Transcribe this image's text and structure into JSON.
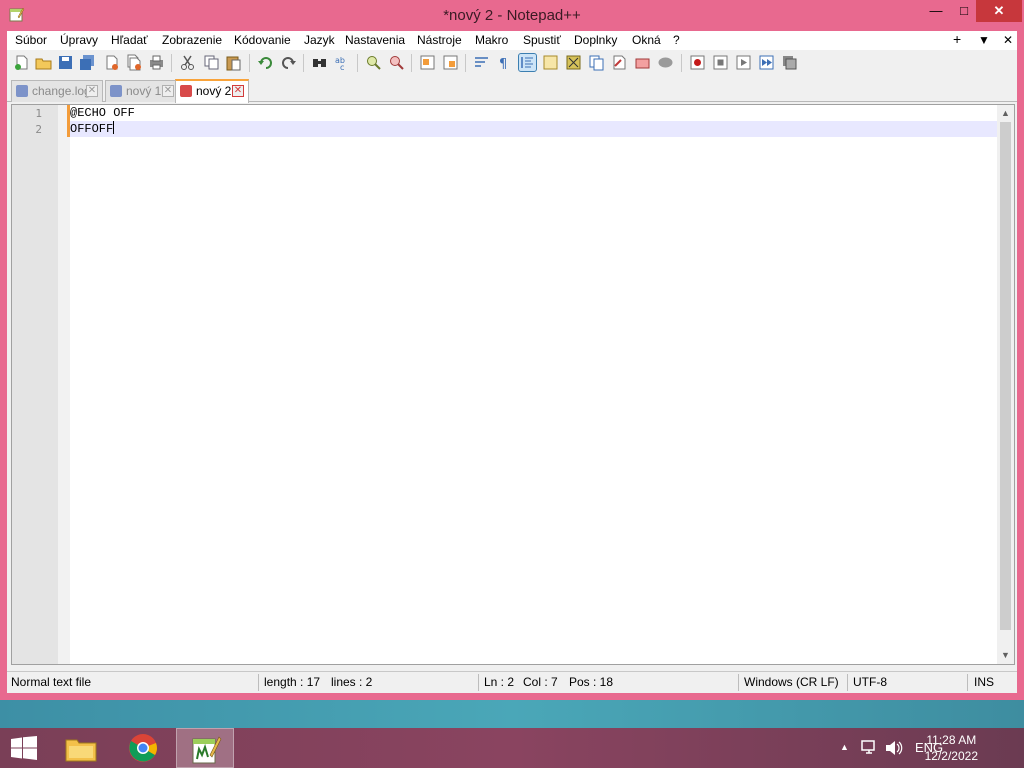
{
  "window": {
    "title": "*nový 2 - Notepad++",
    "min_glyph": "—",
    "max_glyph": "□",
    "close_glyph": "✕"
  },
  "menu": {
    "items": [
      "Súbor",
      "Úpravy",
      "Hľadať",
      "Zobrazenie",
      "Kódovanie",
      "Jazyk",
      "Nastavenia",
      "Nástroje",
      "Makro",
      "Spustiť",
      "Doplnky",
      "Okná",
      "?"
    ],
    "right": [
      "+",
      "▼",
      "✕"
    ]
  },
  "tabs": [
    {
      "label": "change.log",
      "active": false
    },
    {
      "label": "nový 1",
      "active": false
    },
    {
      "label": "nový 2",
      "active": true
    }
  ],
  "editor": {
    "lines": [
      {
        "number": "1",
        "text": "@ECHO OFF"
      },
      {
        "number": "2",
        "text": "OFFOFF"
      }
    ],
    "current_line": 2
  },
  "status": {
    "type": "Normal text file",
    "length": "length : 17",
    "lines": "lines : 2",
    "ln": "Ln : 2",
    "col": "Col : 7",
    "pos": "Pos : 18",
    "eol": "Windows (CR LF)",
    "encoding": "UTF-8",
    "mode": "INS"
  },
  "taskbar": {
    "language": "ENG",
    "time": "11:28 AM",
    "date": "12/2/2022"
  },
  "colors": {
    "frame": "#e8698f",
    "tab_accent": "#f9a33a",
    "current_line": "#e8e8ff",
    "change_marker": "#f39c3a"
  }
}
